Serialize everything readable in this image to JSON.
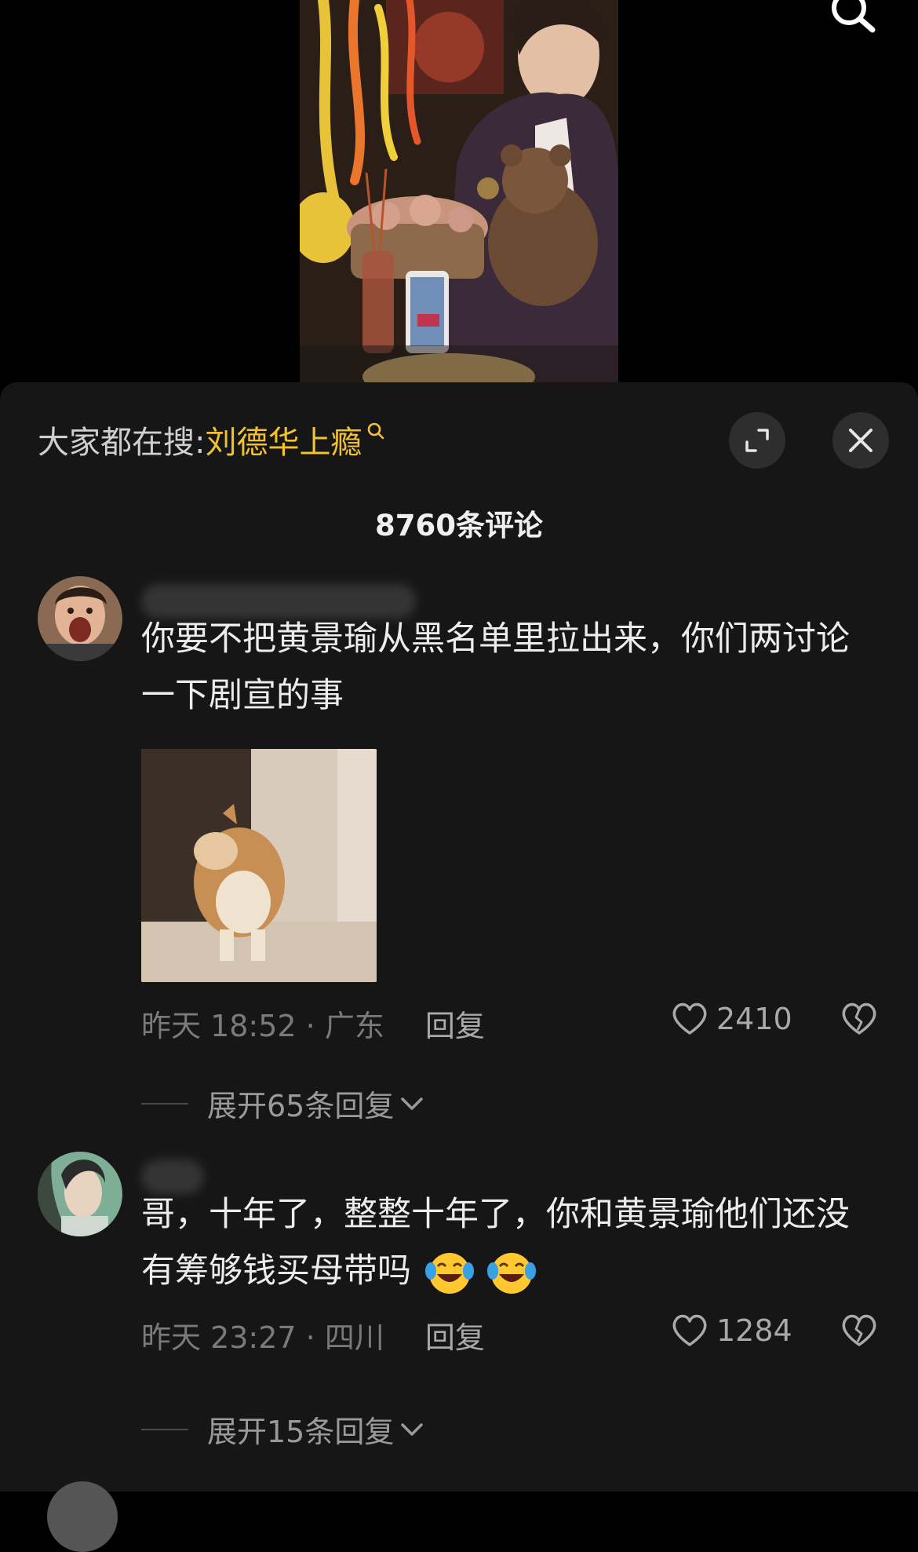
{
  "video": {
    "description_icons": [
      "search-icon"
    ]
  },
  "search_bar": {
    "prefix": "大家都在搜:",
    "term": "刘德华上瘾"
  },
  "comment_count": "8760条评论",
  "comments": [
    {
      "text": "你要不把黄景瑜从黑名单里拉出来，你们两讨论一下剧宣的事",
      "time_location": "昨天 18:52 · 广东",
      "reply_label": "回复",
      "likes": "2410",
      "expand_label": "展开65条回复",
      "has_image": true
    },
    {
      "text": "哥，十年了，整整十年了，你和黄景瑜他们还没有筹够钱买母带吗",
      "emoji": "laughing-crying-emoji",
      "time_location": "昨天 23:27 · 四川",
      "reply_label": "回复",
      "likes": "1284",
      "expand_label": "展开15条回复",
      "has_image": false
    }
  ],
  "colors": {
    "accent": "#f2c230",
    "sheet_bg": "#161616",
    "text": "#ececec",
    "muted": "#7a7a7a"
  }
}
